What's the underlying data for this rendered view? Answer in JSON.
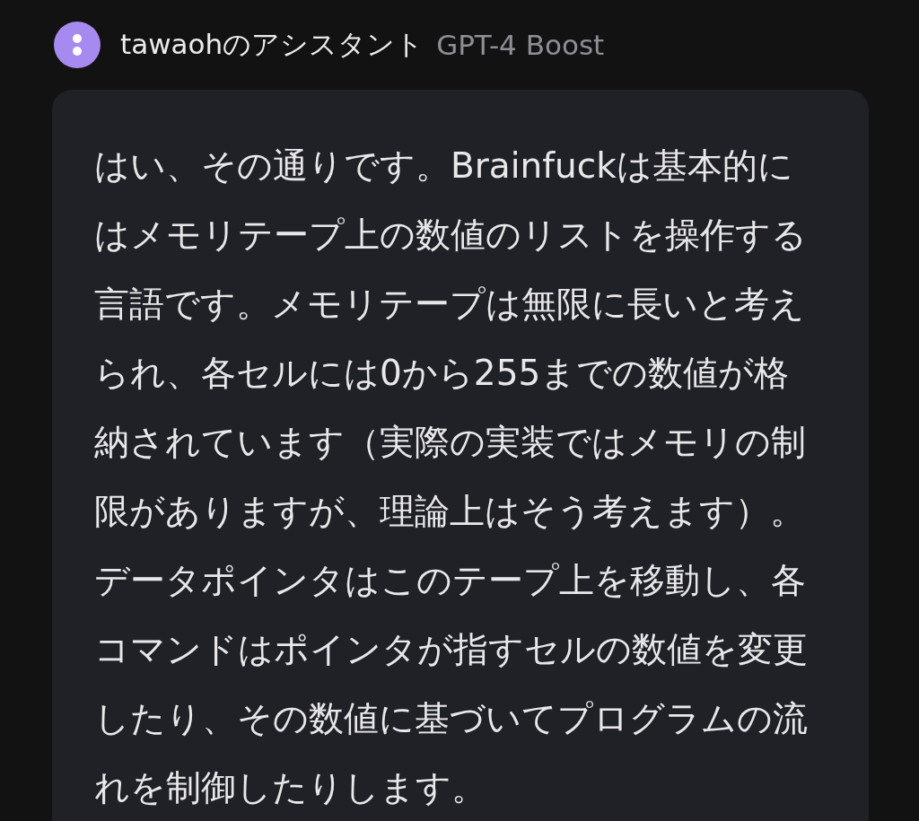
{
  "header": {
    "assistant_name": "tawaohのアシスタント",
    "model": "GPT-4 Boost"
  },
  "message": {
    "text": "はい、その通りです。Brainfuckは基本的にはメモリテープ上の数値のリストを操作する言語です。メモリテープは無限に長いと考えられ、各セルには0から255までの数値が格納されています（実際の実装ではメモリの制限がありますが、理論上はそう考えます）。データポインタはこのテープ上を移動し、各コマンドはポインタが指すセルの数値を変更したり、その数値に基づいてプログラムの流れを制御したりします。"
  }
}
